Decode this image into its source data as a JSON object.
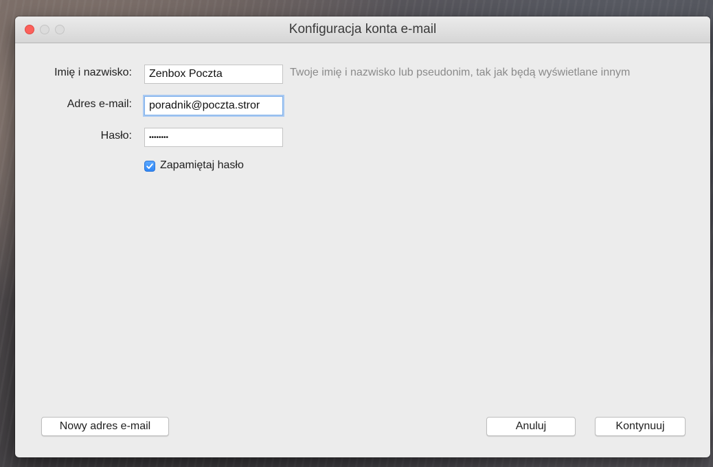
{
  "window": {
    "title": "Konfiguracja konta e-mail"
  },
  "form": {
    "name": {
      "label": "Imię i nazwisko:",
      "value": "Zenbox Poczta",
      "hint": "Twoje imię i nazwisko lub pseudonim, tak jak będą wyświetlane innym"
    },
    "email": {
      "label": "Adres e-mail:",
      "value": "poradnik@poczta.stror"
    },
    "password": {
      "label": "Hasło:",
      "value": "••••••••"
    },
    "remember": {
      "label": "Zapamiętaj hasło",
      "checked": true
    }
  },
  "buttons": {
    "new_address": "Nowy adres e-mail",
    "cancel": "Anuluj",
    "continue": "Kontynuuj"
  },
  "colors": {
    "close_button": "#fc605b",
    "checkbox_accent": "#2f86f5",
    "focus_ring": "#a8c9f2"
  }
}
